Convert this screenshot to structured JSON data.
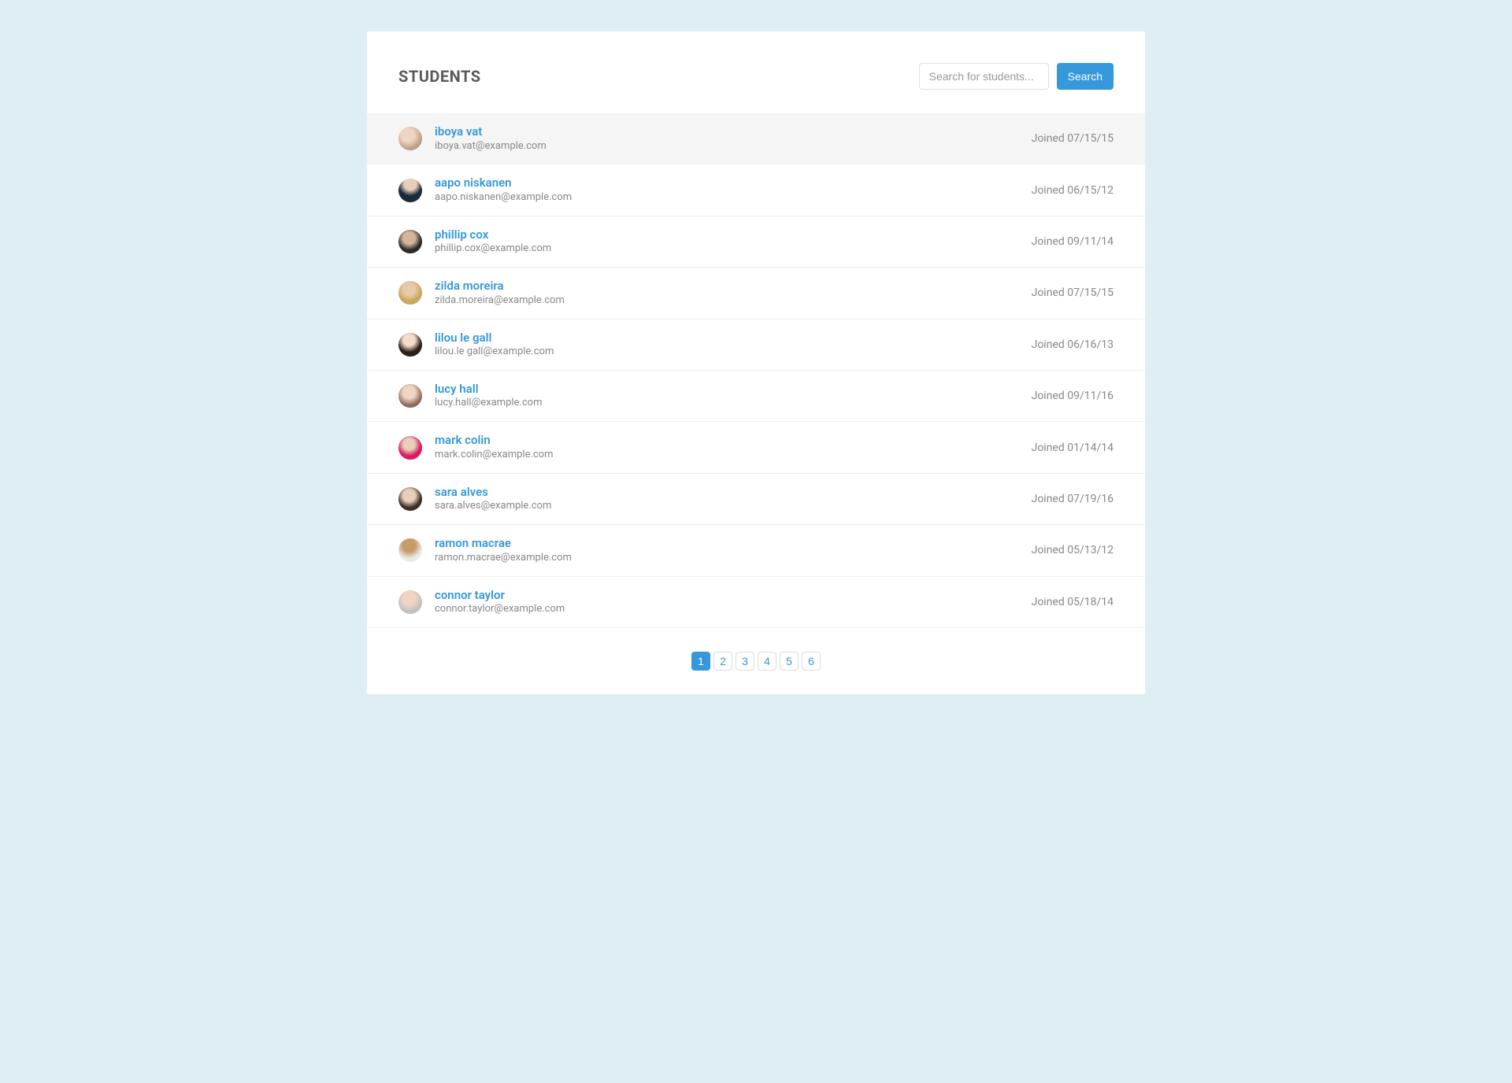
{
  "header": {
    "title": "STUDENTS"
  },
  "search": {
    "placeholder": "Search for students...",
    "button_label": "Search",
    "value": ""
  },
  "joined_prefix": "Joined ",
  "students": [
    {
      "name": "iboya vat",
      "email": "iboya.vat@example.com",
      "joined": "07/15/15",
      "highlighted": true
    },
    {
      "name": "aapo niskanen",
      "email": "aapo.niskanen@example.com",
      "joined": "06/15/12",
      "highlighted": false
    },
    {
      "name": "phillip cox",
      "email": "phillip.cox@example.com",
      "joined": "09/11/14",
      "highlighted": false
    },
    {
      "name": "zilda moreira",
      "email": "zilda.moreira@example.com",
      "joined": "07/15/15",
      "highlighted": false
    },
    {
      "name": "lilou le gall",
      "email": "lilou.le gall@example.com",
      "joined": "06/16/13",
      "highlighted": false
    },
    {
      "name": "lucy hall",
      "email": "lucy.hall@example.com",
      "joined": "09/11/16",
      "highlighted": false
    },
    {
      "name": "mark colin",
      "email": "mark.colin@example.com",
      "joined": "01/14/14",
      "highlighted": false
    },
    {
      "name": "sara alves",
      "email": "sara.alves@example.com",
      "joined": "07/19/16",
      "highlighted": false
    },
    {
      "name": "ramon macrae",
      "email": "ramon.macrae@example.com",
      "joined": "05/13/12",
      "highlighted": false
    },
    {
      "name": "connor taylor",
      "email": "connor.taylor@example.com",
      "joined": "05/18/14",
      "highlighted": false
    }
  ],
  "pagination": {
    "pages": [
      "1",
      "2",
      "3",
      "4",
      "5",
      "6"
    ],
    "active": "1"
  }
}
